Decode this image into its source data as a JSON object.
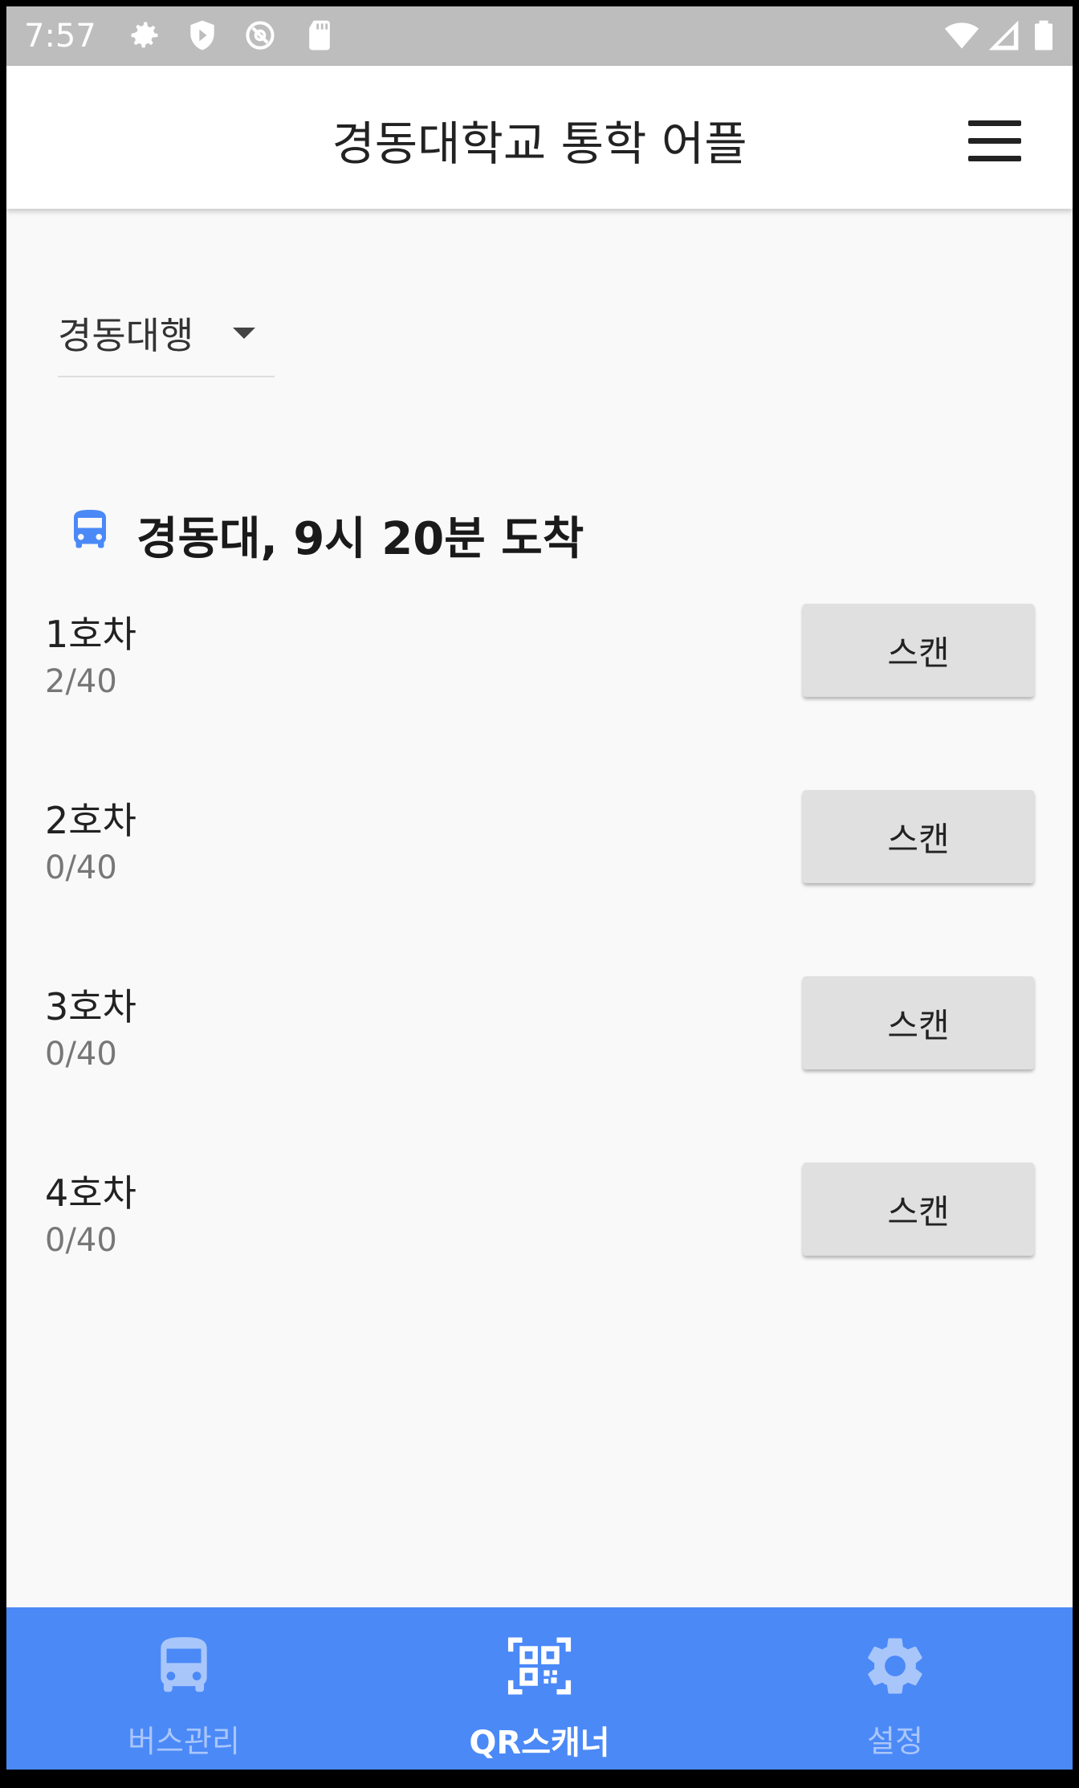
{
  "status_bar": {
    "time": "7:57"
  },
  "app_bar": {
    "title": "경동대학교 통학 어플"
  },
  "direction_select": {
    "selected": "경동대행"
  },
  "schedule": {
    "heading": "경동대, 9시 20분 도착",
    "buses": [
      {
        "name": "1호차",
        "count": "2/40",
        "button": "스캔"
      },
      {
        "name": "2호차",
        "count": "0/40",
        "button": "스캔"
      },
      {
        "name": "3호차",
        "count": "0/40",
        "button": "스캔"
      },
      {
        "name": "4호차",
        "count": "0/40",
        "button": "스캔"
      }
    ]
  },
  "bottom_nav": {
    "items": [
      {
        "label": "버스관리",
        "icon": "bus-icon",
        "active": false
      },
      {
        "label": "QR스캐너",
        "icon": "qr-scanner-icon",
        "active": true
      },
      {
        "label": "설정",
        "icon": "gear-icon",
        "active": false
      }
    ]
  },
  "colors": {
    "accent": "#4b89f7",
    "bus_icon": "#4b89f7",
    "status_bar": "#bdbdbd"
  }
}
